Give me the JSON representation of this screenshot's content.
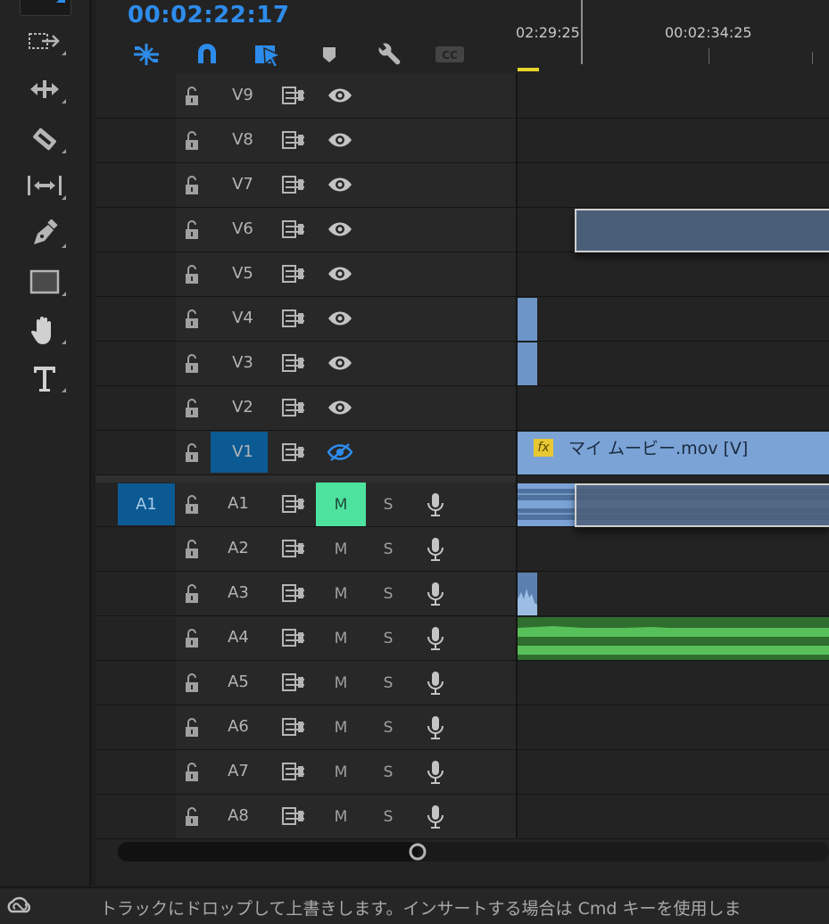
{
  "timecode": "00:02:22:17",
  "ruler": {
    "labels": [
      "02:29:25",
      "00:02:34:25"
    ]
  },
  "tools": [
    "selection-tool",
    "track-select-tool",
    "ripple-edit-tool",
    "razor-tool",
    "slip-tool",
    "pen-tool",
    "rectangle-tool",
    "hand-tool",
    "type-tool"
  ],
  "timeline_tools": [
    "snap-in-timeline",
    "linked-selection",
    "insert-overwrite-sequences",
    "add-marker",
    "timeline-settings",
    "closed-captions"
  ],
  "video_tracks": [
    {
      "name": "V9"
    },
    {
      "name": "V8"
    },
    {
      "name": "V7"
    },
    {
      "name": "V6"
    },
    {
      "name": "V5"
    },
    {
      "name": "V4"
    },
    {
      "name": "V3"
    },
    {
      "name": "V2"
    },
    {
      "name": "V1",
      "targeted": true,
      "hidden": true
    }
  ],
  "audio_tracks": [
    {
      "name": "A1",
      "source": "A1",
      "muted": true
    },
    {
      "name": "A2"
    },
    {
      "name": "A3"
    },
    {
      "name": "A4"
    },
    {
      "name": "A5"
    },
    {
      "name": "A6"
    },
    {
      "name": "A7"
    },
    {
      "name": "A8"
    }
  ],
  "labels": {
    "mute": "M",
    "solo": "S"
  },
  "clip": {
    "name": "マイ ムービー.mov [V]",
    "fx": "fx"
  },
  "status": "トラックにドロップして上書きします。インサートする場合は Cmd キーを使用しま",
  "colors": {
    "accent": "#2d8ceb",
    "video_clip": "#7ba3d6",
    "clip_ghost": "#4b5e78",
    "audio_green": "#4cb04c",
    "mute_on": "#4de39f"
  }
}
